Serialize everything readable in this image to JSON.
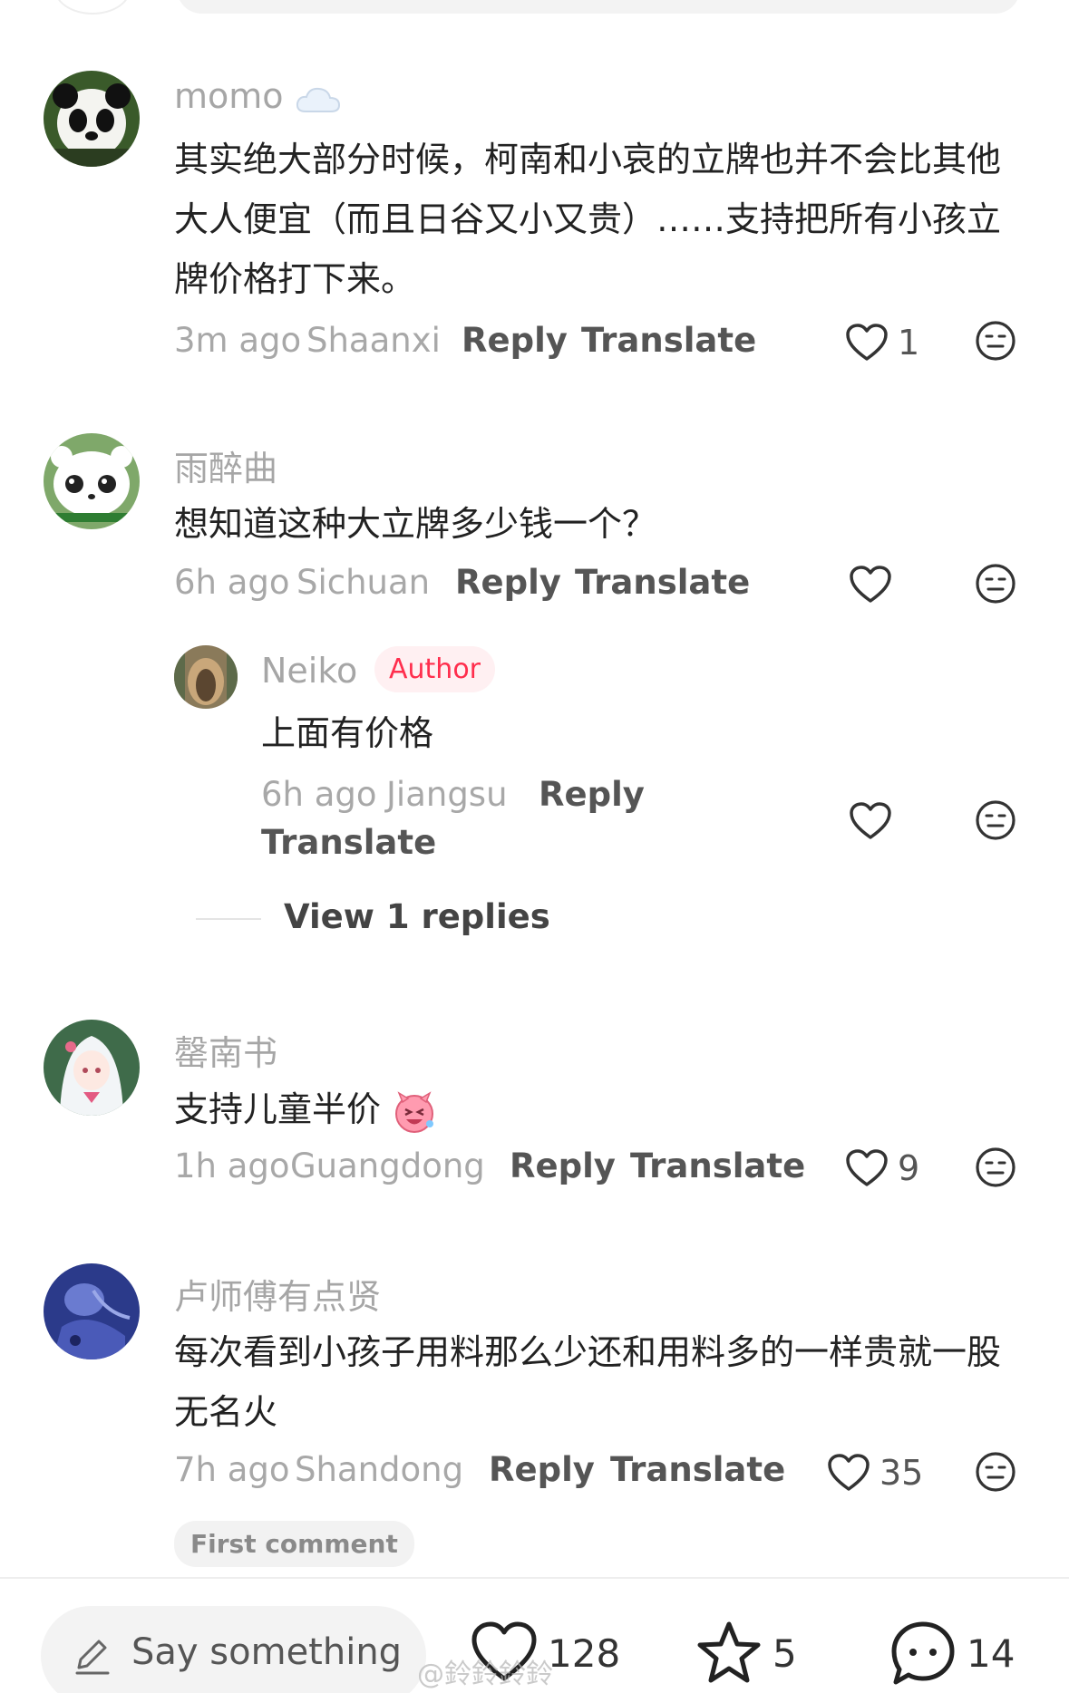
{
  "comments": [
    {
      "username": "momo",
      "username_suffix_icon": "cloud-icon",
      "text": "其实绝大部分时候，柯南和小哀的立牌也并不会比其他大人便宜（而且日谷又小又贵）……支持把所有小孩立牌价格打下来。",
      "time": "3m ago",
      "location": "Shaanxi",
      "reply_label": "Reply",
      "translate_label": "Translate",
      "likes": "1"
    },
    {
      "username": "雨醉曲",
      "text": "想知道这种大立牌多少钱一个？",
      "time": "6h ago",
      "location": "Sichuan",
      "reply_label": "Reply",
      "translate_label": "Translate",
      "likes": "",
      "reply": {
        "username": "Neiko",
        "badge": "Author",
        "text": "上面有价格",
        "time": "6h ago",
        "location": "Jiangsu",
        "reply_label": "Reply",
        "translate_label": "Translate",
        "likes": ""
      },
      "view_replies_label": "View 1 replies"
    },
    {
      "username": "罄南书",
      "text": "支持儿童半价",
      "emoji": "laughing-pig-emoji",
      "time": "1h ago",
      "location": "Guangdong",
      "reply_label": "Reply",
      "translate_label": "Translate",
      "likes": "9"
    },
    {
      "username": "卢师傅有点贤",
      "text": "每次看到小孩子用料那么少还和用料多的一样贵就一股无名火",
      "time": "7h ago",
      "location": "Shandong",
      "reply_label": "Reply",
      "translate_label": "Translate",
      "likes": "35",
      "first_comment_badge": "First comment"
    }
  ],
  "bottom_bar": {
    "input_placeholder": "Say something",
    "likes": "128",
    "favorites": "5",
    "comments": "14",
    "watermark": "@鈴鈴鈴鈴"
  },
  "colors": {
    "author_badge_text": "#ff2e4d",
    "author_badge_bg": "#fff0f2"
  }
}
